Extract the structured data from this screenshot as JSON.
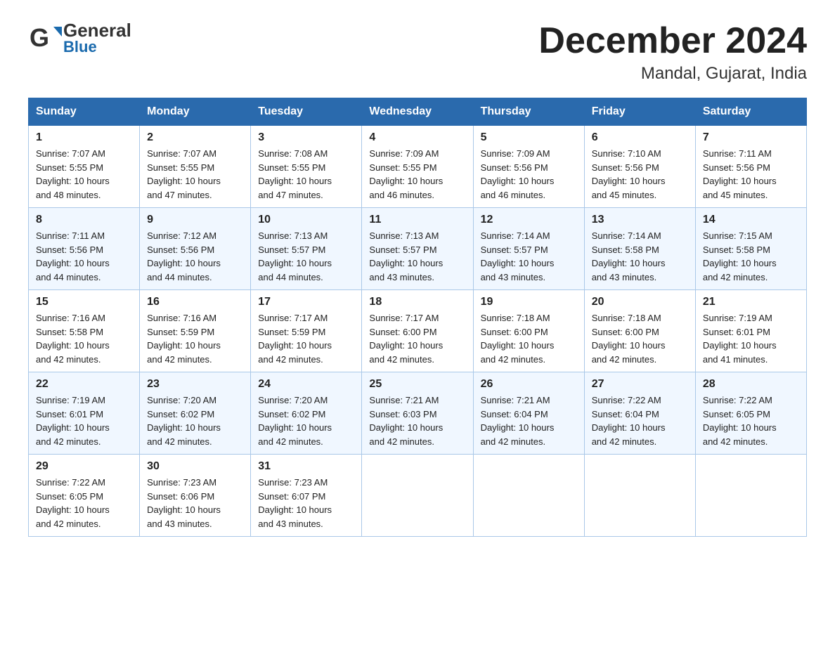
{
  "header": {
    "logo_general": "General",
    "logo_blue": "Blue",
    "title": "December 2024",
    "subtitle": "Mandal, Gujarat, India"
  },
  "weekdays": [
    "Sunday",
    "Monday",
    "Tuesday",
    "Wednesday",
    "Thursday",
    "Friday",
    "Saturday"
  ],
  "weeks": [
    [
      {
        "day": "1",
        "sunrise": "7:07 AM",
        "sunset": "5:55 PM",
        "daylight": "10 hours and 48 minutes."
      },
      {
        "day": "2",
        "sunrise": "7:07 AM",
        "sunset": "5:55 PM",
        "daylight": "10 hours and 47 minutes."
      },
      {
        "day": "3",
        "sunrise": "7:08 AM",
        "sunset": "5:55 PM",
        "daylight": "10 hours and 47 minutes."
      },
      {
        "day": "4",
        "sunrise": "7:09 AM",
        "sunset": "5:55 PM",
        "daylight": "10 hours and 46 minutes."
      },
      {
        "day": "5",
        "sunrise": "7:09 AM",
        "sunset": "5:56 PM",
        "daylight": "10 hours and 46 minutes."
      },
      {
        "day": "6",
        "sunrise": "7:10 AM",
        "sunset": "5:56 PM",
        "daylight": "10 hours and 45 minutes."
      },
      {
        "day": "7",
        "sunrise": "7:11 AM",
        "sunset": "5:56 PM",
        "daylight": "10 hours and 45 minutes."
      }
    ],
    [
      {
        "day": "8",
        "sunrise": "7:11 AM",
        "sunset": "5:56 PM",
        "daylight": "10 hours and 44 minutes."
      },
      {
        "day": "9",
        "sunrise": "7:12 AM",
        "sunset": "5:56 PM",
        "daylight": "10 hours and 44 minutes."
      },
      {
        "day": "10",
        "sunrise": "7:13 AM",
        "sunset": "5:57 PM",
        "daylight": "10 hours and 44 minutes."
      },
      {
        "day": "11",
        "sunrise": "7:13 AM",
        "sunset": "5:57 PM",
        "daylight": "10 hours and 43 minutes."
      },
      {
        "day": "12",
        "sunrise": "7:14 AM",
        "sunset": "5:57 PM",
        "daylight": "10 hours and 43 minutes."
      },
      {
        "day": "13",
        "sunrise": "7:14 AM",
        "sunset": "5:58 PM",
        "daylight": "10 hours and 43 minutes."
      },
      {
        "day": "14",
        "sunrise": "7:15 AM",
        "sunset": "5:58 PM",
        "daylight": "10 hours and 42 minutes."
      }
    ],
    [
      {
        "day": "15",
        "sunrise": "7:16 AM",
        "sunset": "5:58 PM",
        "daylight": "10 hours and 42 minutes."
      },
      {
        "day": "16",
        "sunrise": "7:16 AM",
        "sunset": "5:59 PM",
        "daylight": "10 hours and 42 minutes."
      },
      {
        "day": "17",
        "sunrise": "7:17 AM",
        "sunset": "5:59 PM",
        "daylight": "10 hours and 42 minutes."
      },
      {
        "day": "18",
        "sunrise": "7:17 AM",
        "sunset": "6:00 PM",
        "daylight": "10 hours and 42 minutes."
      },
      {
        "day": "19",
        "sunrise": "7:18 AM",
        "sunset": "6:00 PM",
        "daylight": "10 hours and 42 minutes."
      },
      {
        "day": "20",
        "sunrise": "7:18 AM",
        "sunset": "6:00 PM",
        "daylight": "10 hours and 42 minutes."
      },
      {
        "day": "21",
        "sunrise": "7:19 AM",
        "sunset": "6:01 PM",
        "daylight": "10 hours and 41 minutes."
      }
    ],
    [
      {
        "day": "22",
        "sunrise": "7:19 AM",
        "sunset": "6:01 PM",
        "daylight": "10 hours and 42 minutes."
      },
      {
        "day": "23",
        "sunrise": "7:20 AM",
        "sunset": "6:02 PM",
        "daylight": "10 hours and 42 minutes."
      },
      {
        "day": "24",
        "sunrise": "7:20 AM",
        "sunset": "6:02 PM",
        "daylight": "10 hours and 42 minutes."
      },
      {
        "day": "25",
        "sunrise": "7:21 AM",
        "sunset": "6:03 PM",
        "daylight": "10 hours and 42 minutes."
      },
      {
        "day": "26",
        "sunrise": "7:21 AM",
        "sunset": "6:04 PM",
        "daylight": "10 hours and 42 minutes."
      },
      {
        "day": "27",
        "sunrise": "7:22 AM",
        "sunset": "6:04 PM",
        "daylight": "10 hours and 42 minutes."
      },
      {
        "day": "28",
        "sunrise": "7:22 AM",
        "sunset": "6:05 PM",
        "daylight": "10 hours and 42 minutes."
      }
    ],
    [
      {
        "day": "29",
        "sunrise": "7:22 AM",
        "sunset": "6:05 PM",
        "daylight": "10 hours and 42 minutes."
      },
      {
        "day": "30",
        "sunrise": "7:23 AM",
        "sunset": "6:06 PM",
        "daylight": "10 hours and 43 minutes."
      },
      {
        "day": "31",
        "sunrise": "7:23 AM",
        "sunset": "6:07 PM",
        "daylight": "10 hours and 43 minutes."
      },
      null,
      null,
      null,
      null
    ]
  ],
  "labels": {
    "sunrise": "Sunrise:",
    "sunset": "Sunset:",
    "daylight": "Daylight:"
  }
}
